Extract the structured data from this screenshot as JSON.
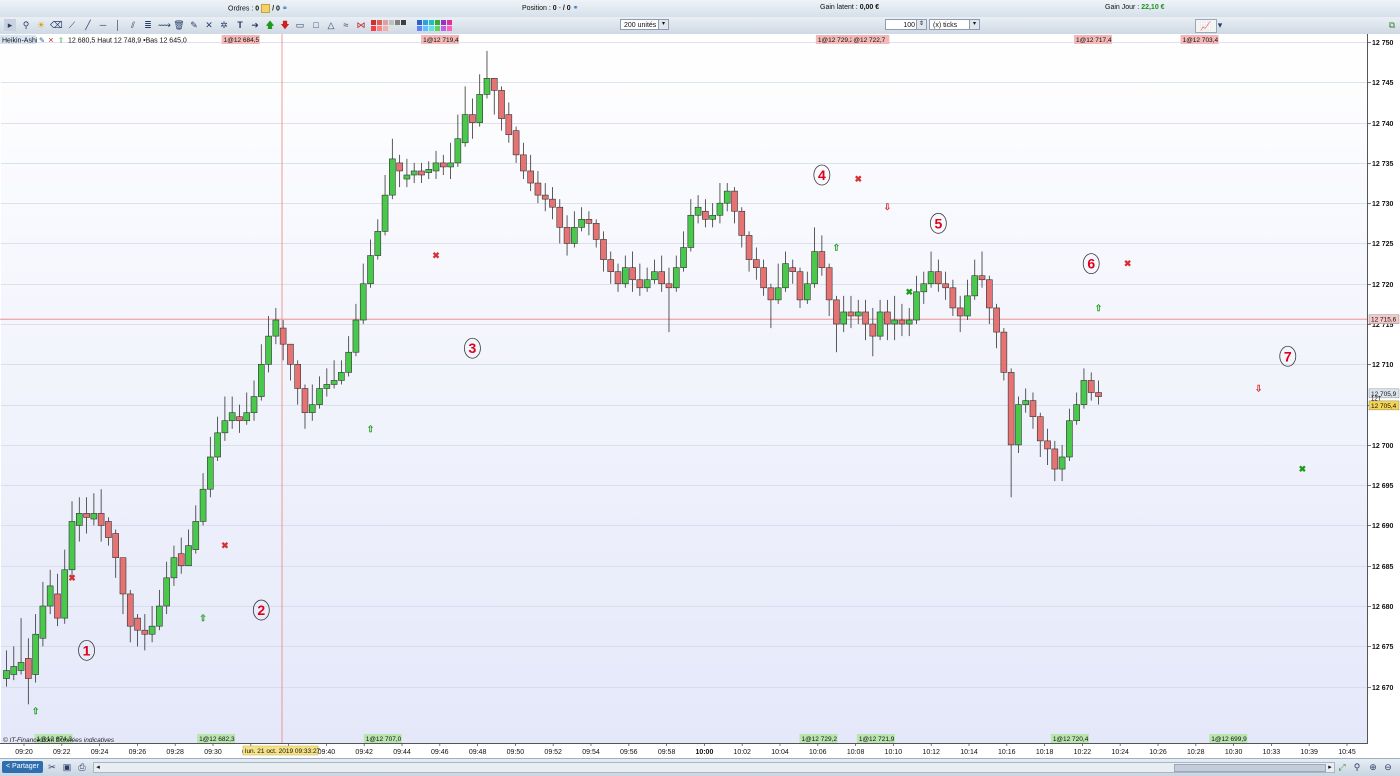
{
  "topbar": {
    "orders_label": "Ordres :",
    "orders_value": "0",
    "orders_sep": "/ 0",
    "position_label": "Position :",
    "position_value": "0",
    "position_dash": "-",
    "position_sep": "/ 0",
    "gain_latent_label": "Gain latent :",
    "gain_latent_value": "0,00 €",
    "gain_jour_label": "Gain Jour :",
    "gain_jour_value": "22,10 €"
  },
  "toolbar": {
    "units_select": "200 unités",
    "ticks_qty": "100",
    "ticks_select": "(x) ticks"
  },
  "legend": {
    "chart_label": "Heikin-Ashi",
    "hl_text": "12 680,5 Haut 12 748,9 •Bas 12 645,0"
  },
  "footer": {
    "copyright": "© IT-Finance.com Données indicatives",
    "date_cursor": "lun. 21 oct. 2019 09:33:27"
  },
  "bottombar": {
    "share_label": "Partager"
  },
  "colors": {
    "bull": "#49c84c",
    "bear": "#e67373",
    "background_top": "#ffffff",
    "background_bottom": "#e4e8f9",
    "crosshair": "#ee8080",
    "annotation": "#e0001a"
  },
  "chart_data": {
    "type": "candlestick",
    "series_name": "Heikin-Ashi",
    "y_ticks": [
      12670,
      12675,
      12680,
      12685,
      12690,
      12695,
      12700,
      12705,
      12710,
      12715,
      12720,
      12725,
      12730,
      12735,
      12740,
      12745,
      12750
    ],
    "y_tick_labels": [
      "12 670",
      "12 675",
      "12 680",
      "12 685",
      "12 690",
      "12 695",
      "12 700",
      "12 705",
      "12 710",
      "12 715",
      "12 720",
      "12 725",
      "12 730",
      "12 735",
      "12 740",
      "12 745",
      "12 750"
    ],
    "ylim": [
      12663,
      12751
    ],
    "x_labels": [
      "09:20",
      "09:22",
      "09:24",
      "09:26",
      "09:28",
      "09:30",
      "09:36",
      "09:38",
      "09:40",
      "09:42",
      "09:44",
      "09:46",
      "09:48",
      "09:50",
      "09:52",
      "09:54",
      "09:56",
      "09:58",
      "10:00",
      "10:02",
      "10:04",
      "10:06",
      "10:08",
      "10:10",
      "10:12",
      "10:14",
      "10:16",
      "10:18",
      "10:22",
      "10:24",
      "10:26",
      "10:28",
      "10:30",
      "10:33",
      "10:39",
      "10:45"
    ],
    "crosshair_price_label": "12 715,6",
    "crosshair_price": 12715.6,
    "last_price_label": "12 705,9",
    "last_price": 12705.9,
    "ticks_badge": "12T",
    "second_price_label": "12 705,4",
    "second_price": 12705.4,
    "candles": [
      [
        12671.0,
        12672.0,
        12674.5,
        12670.0
      ],
      [
        12671.5,
        12672.5,
        12675.0,
        12670.8
      ],
      [
        12672.0,
        12673.0,
        12678.5,
        12671.5
      ],
      [
        12673.5,
        12671.0,
        12676.0,
        12667.8
      ],
      [
        12671.5,
        12676.5,
        12679.0,
        12670.5
      ],
      [
        12676.0,
        12680.0,
        12683.0,
        12675.0
      ],
      [
        12680.0,
        12682.5,
        12684.5,
        12679.0
      ],
      [
        12681.5,
        12678.5,
        12684.0,
        12677.5
      ],
      [
        12678.5,
        12684.5,
        12687.0,
        12677.8
      ],
      [
        12684.5,
        12690.5,
        12693.0,
        12683.5
      ],
      [
        12690.0,
        12691.5,
        12693.5,
        12688.0
      ],
      [
        12691.5,
        12691.0,
        12693.5,
        12689.0
      ],
      [
        12690.8,
        12691.5,
        12694.0,
        12690.0
      ],
      [
        12691.5,
        12690.0,
        12694.5,
        12688.0
      ],
      [
        12690.5,
        12688.5,
        12691.0,
        12687.5
      ],
      [
        12689.0,
        12686.0,
        12689.5,
        12683.5
      ],
      [
        12686.0,
        12681.5,
        12686.0,
        12679.0
      ],
      [
        12681.5,
        12677.5,
        12682.0,
        12675.5
      ],
      [
        12678.5,
        12677.0,
        12679.0,
        12675.0
      ],
      [
        12677.0,
        12676.5,
        12679.0,
        12674.5
      ],
      [
        12676.5,
        12677.5,
        12680.0,
        12675.5
      ],
      [
        12677.5,
        12680.0,
        12682.0,
        12677.0
      ],
      [
        12680.0,
        12683.5,
        12685.5,
        12679.0
      ],
      [
        12683.5,
        12686.0,
        12687.5,
        12682.5
      ],
      [
        12686.5,
        12685.0,
        12688.5,
        12684.0
      ],
      [
        12685.0,
        12687.5,
        12689.5,
        12685.0
      ],
      [
        12687.0,
        12690.5,
        12692.5,
        12686.5
      ],
      [
        12690.5,
        12694.5,
        12696.5,
        12690.0
      ],
      [
        12694.5,
        12698.5,
        12701.0,
        12693.5
      ],
      [
        12698.5,
        12701.5,
        12703.5,
        12698.0
      ],
      [
        12701.5,
        12703.0,
        12706.0,
        12700.5
      ],
      [
        12703.0,
        12704.0,
        12706.0,
        12702.0
      ],
      [
        12703.5,
        12703.0,
        12705.0,
        12701.5
      ],
      [
        12703.0,
        12704.0,
        12706.5,
        12702.5
      ],
      [
        12704.0,
        12706.0,
        12708.0,
        12703.0
      ],
      [
        12706.0,
        12710.0,
        12712.5,
        12705.5
      ],
      [
        12710.0,
        12713.5,
        12716.0,
        12709.0
      ],
      [
        12713.5,
        12715.5,
        12717.0,
        12712.5
      ],
      [
        12714.5,
        12712.5,
        12715.5,
        12710.5
      ],
      [
        12712.5,
        12710.0,
        12712.5,
        12708.0
      ],
      [
        12710.0,
        12707.0,
        12710.5,
        12705.0
      ],
      [
        12707.0,
        12704.0,
        12707.5,
        12702.0
      ],
      [
        12704.0,
        12705.0,
        12707.5,
        12703.0
      ],
      [
        12705.0,
        12707.0,
        12708.5,
        12704.5
      ],
      [
        12707.0,
        12707.5,
        12709.5,
        12706.0
      ],
      [
        12707.5,
        12708.0,
        12710.5,
        12707.0
      ],
      [
        12708.0,
        12709.0,
        12710.5,
        12707.5
      ],
      [
        12709.0,
        12711.5,
        12713.5,
        12708.5
      ],
      [
        12711.5,
        12715.5,
        12717.5,
        12711.0
      ],
      [
        12715.5,
        12720.0,
        12722.5,
        12715.0
      ],
      [
        12720.0,
        12723.5,
        12725.5,
        12719.5
      ],
      [
        12723.5,
        12726.5,
        12728.0,
        12723.0
      ],
      [
        12726.5,
        12731.0,
        12733.5,
        12726.0
      ],
      [
        12731.0,
        12735.5,
        12738.0,
        12730.5
      ],
      [
        12735.0,
        12734.0,
        12736.0,
        12732.0
      ],
      [
        12733.0,
        12733.5,
        12735.5,
        12732.0
      ],
      [
        12733.5,
        12734.0,
        12735.0,
        12732.5
      ],
      [
        12734.0,
        12733.5,
        12735.0,
        12732.5
      ],
      [
        12733.8,
        12734.2,
        12735.2,
        12733.0
      ],
      [
        12734.0,
        12735.0,
        12736.5,
        12733.0
      ],
      [
        12735.0,
        12734.5,
        12736.0,
        12733.5
      ],
      [
        12734.5,
        12735.0,
        12737.5,
        12733.0
      ],
      [
        12735.0,
        12738.0,
        12741.0,
        12734.5
      ],
      [
        12737.5,
        12741.0,
        12744.5,
        12737.0
      ],
      [
        12741.0,
        12740.0,
        12743.0,
        12738.0
      ],
      [
        12740.0,
        12743.5,
        12746.0,
        12739.5
      ],
      [
        12743.5,
        12745.5,
        12748.9,
        12743.0
      ],
      [
        12745.5,
        12744.0,
        12745.5,
        12741.0
      ],
      [
        12744.0,
        12740.5,
        12744.5,
        12739.0
      ],
      [
        12741.0,
        12738.5,
        12742.5,
        12737.5
      ],
      [
        12739.0,
        12736.0,
        12739.5,
        12735.0
      ],
      [
        12736.0,
        12734.0,
        12737.5,
        12733.0
      ],
      [
        12734.0,
        12732.5,
        12736.0,
        12731.5
      ],
      [
        12732.5,
        12731.0,
        12734.0,
        12730.0
      ],
      [
        12731.0,
        12730.5,
        12732.5,
        12729.0
      ],
      [
        12730.5,
        12729.5,
        12732.0,
        12728.0
      ],
      [
        12729.5,
        12727.0,
        12730.5,
        12725.0
      ],
      [
        12727.0,
        12725.0,
        12728.5,
        12723.5
      ],
      [
        12725.0,
        12727.0,
        12729.0,
        12724.5
      ],
      [
        12727.0,
        12728.0,
        12729.5,
        12726.5
      ],
      [
        12728.0,
        12727.5,
        12729.0,
        12726.0
      ],
      [
        12727.5,
        12725.5,
        12728.0,
        12724.5
      ],
      [
        12725.5,
        12723.0,
        12726.5,
        12721.5
      ],
      [
        12723.0,
        12721.5,
        12724.0,
        12720.0
      ],
      [
        12721.5,
        12720.0,
        12722.5,
        12719.0
      ],
      [
        12720.0,
        12722.0,
        12723.5,
        12719.5
      ],
      [
        12722.0,
        12720.5,
        12724.0,
        12719.0
      ],
      [
        12720.5,
        12719.5,
        12722.5,
        12718.5
      ],
      [
        12719.5,
        12720.5,
        12722.0,
        12719.0
      ],
      [
        12720.5,
        12721.5,
        12723.0,
        12720.0
      ],
      [
        12721.5,
        12720.0,
        12723.5,
        12719.0
      ],
      [
        12720.0,
        12719.5,
        12722.0,
        12714.0
      ],
      [
        12719.5,
        12722.0,
        12723.5,
        12719.0
      ],
      [
        12722.0,
        12724.5,
        12726.5,
        12721.5
      ],
      [
        12724.5,
        12728.5,
        12730.5,
        12724.0
      ],
      [
        12728.5,
        12729.5,
        12731.0,
        12727.5
      ],
      [
        12729.0,
        12728.0,
        12730.5,
        12727.0
      ],
      [
        12728.0,
        12728.5,
        12730.0,
        12727.0
      ],
      [
        12728.5,
        12730.0,
        12732.5,
        12727.5
      ],
      [
        12730.0,
        12731.5,
        12732.5,
        12729.0
      ],
      [
        12731.5,
        12729.0,
        12732.0,
        12727.5
      ],
      [
        12729.0,
        12726.0,
        12729.5,
        12724.5
      ],
      [
        12726.0,
        12723.0,
        12726.5,
        12721.5
      ],
      [
        12723.0,
        12722.0,
        12724.5,
        12720.5
      ],
      [
        12722.0,
        12719.5,
        12723.0,
        12718.5
      ],
      [
        12719.5,
        12718.0,
        12720.0,
        12714.5
      ],
      [
        12718.0,
        12719.5,
        12722.5,
        12717.5
      ],
      [
        12719.5,
        12722.5,
        12724.0,
        12719.0
      ],
      [
        12722.0,
        12721.5,
        12723.0,
        12720.0
      ],
      [
        12721.5,
        12718.0,
        12722.0,
        12717.0
      ],
      [
        12718.0,
        12720.0,
        12721.5,
        12717.5
      ],
      [
        12720.0,
        12724.0,
        12727.0,
        12719.5
      ],
      [
        12724.0,
        12722.0,
        12726.0,
        12721.0
      ],
      [
        12722.0,
        12718.0,
        12722.5,
        12716.0
      ],
      [
        12718.0,
        12715.0,
        12718.5,
        12711.5
      ],
      [
        12715.0,
        12716.5,
        12718.5,
        12714.0
      ],
      [
        12716.5,
        12716.0,
        12718.5,
        12714.5
      ],
      [
        12716.0,
        12716.5,
        12718.0,
        12715.0
      ],
      [
        12716.5,
        12715.0,
        12718.0,
        12713.0
      ],
      [
        12715.0,
        12713.5,
        12717.0,
        12711.0
      ],
      [
        12713.5,
        12716.5,
        12718.0,
        12713.0
      ],
      [
        12716.5,
        12715.0,
        12718.0,
        12713.0
      ],
      [
        12715.0,
        12715.5,
        12718.5,
        12713.0
      ],
      [
        12715.5,
        12715.0,
        12717.5,
        12713.5
      ],
      [
        12715.0,
        12715.5,
        12717.0,
        12713.5
      ],
      [
        12715.5,
        12719.0,
        12721.0,
        12715.0
      ],
      [
        12719.0,
        12720.0,
        12721.5,
        12717.5
      ],
      [
        12720.0,
        12721.5,
        12724.0,
        12719.5
      ],
      [
        12721.5,
        12720.0,
        12723.0,
        12719.0
      ],
      [
        12720.0,
        12719.5,
        12721.5,
        12718.0
      ],
      [
        12719.5,
        12717.0,
        12720.5,
        12716.0
      ],
      [
        12717.0,
        12716.0,
        12718.5,
        12714.0
      ],
      [
        12716.0,
        12718.5,
        12720.5,
        12715.5
      ],
      [
        12718.5,
        12721.0,
        12723.0,
        12718.0
      ],
      [
        12721.0,
        12720.5,
        12724.0,
        12719.5
      ],
      [
        12720.5,
        12717.0,
        12721.0,
        12715.0
      ],
      [
        12717.0,
        12714.0,
        12717.5,
        12712.0
      ],
      [
        12714.0,
        12709.0,
        12714.5,
        12708.0
      ],
      [
        12709.0,
        12700.0,
        12709.5,
        12693.5
      ],
      [
        12700.0,
        12705.0,
        12706.0,
        12699.0
      ],
      [
        12705.0,
        12705.5,
        12707.0,
        12704.0
      ],
      [
        12705.5,
        12703.5,
        12706.5,
        12702.0
      ],
      [
        12703.5,
        12700.5,
        12704.0,
        12698.5
      ],
      [
        12700.5,
        12699.5,
        12702.0,
        12697.5
      ],
      [
        12699.5,
        12697.0,
        12700.5,
        12695.5
      ],
      [
        12697.0,
        12698.5,
        12700.0,
        12695.5
      ],
      [
        12698.5,
        12703.0,
        12704.5,
        12698.0
      ],
      [
        12703.0,
        12705.0,
        12706.5,
        12702.5
      ],
      [
        12705.0,
        12708.0,
        12709.5,
        12704.5
      ],
      [
        12708.0,
        12706.5,
        12709.0,
        12705.5
      ],
      [
        12706.5,
        12706.0,
        12708.0,
        12705.0
      ]
    ],
    "top_labels": [
      {
        "text": "1@12 684,5",
        "x_frac": 0.163
      },
      {
        "text": "1@12 719,4",
        "x_frac": 0.309
      },
      {
        "text": "1@12 729,2",
        "x_frac": 0.598
      },
      {
        "text": "@12 722,7",
        "x_frac": 0.624
      },
      {
        "text": "1@12 717,4",
        "x_frac": 0.787
      },
      {
        "text": "1@12 703,4",
        "x_frac": 0.865
      }
    ],
    "bottom_labels": [
      {
        "text": "1@12 674,3",
        "x_frac": 0.026
      },
      {
        "text": "1@12 682,3",
        "x_frac": 0.145
      },
      {
        "text": "1@12 707,0",
        "x_frac": 0.267
      },
      {
        "text": "1@12 729,2",
        "x_frac": 0.586
      },
      {
        "text": "1@12 721,9",
        "x_frac": 0.628
      },
      {
        "text": "1@12 720,4",
        "x_frac": 0.77
      },
      {
        "text": "1@12 699,9",
        "x_frac": 0.886
      }
    ],
    "annotations": [
      {
        "text": "1",
        "idx": 11,
        "price": 12674.5
      },
      {
        "text": "2",
        "idx": 35,
        "price": 12679.5
      },
      {
        "text": "3",
        "idx": 64,
        "price": 12712.0
      },
      {
        "text": "4",
        "idx": 112,
        "price": 12733.5
      },
      {
        "text": "5",
        "idx": 128,
        "price": 12727.5
      },
      {
        "text": "6",
        "idx": 149,
        "price": 12722.5
      },
      {
        "text": "7",
        "idx": 176,
        "price": 12711.0
      }
    ],
    "markers": [
      {
        "type": "buy-arrow",
        "idx": 4,
        "price": 12667.0
      },
      {
        "type": "sell-x",
        "idx": 9,
        "price": 12683.5
      },
      {
        "type": "buy-arrow",
        "idx": 27,
        "price": 12678.5
      },
      {
        "type": "sell-x",
        "idx": 30,
        "price": 12687.5
      },
      {
        "type": "buy-arrow",
        "idx": 50,
        "price": 12702.0
      },
      {
        "type": "sell-x",
        "idx": 59,
        "price": 12723.5
      },
      {
        "type": "buy-arrow",
        "idx": 114,
        "price": 12724.5
      },
      {
        "type": "sell-x",
        "idx": 117,
        "price": 12733.0
      },
      {
        "type": "sell-arrow",
        "idx": 121,
        "price": 12729.5
      },
      {
        "type": "buy-x",
        "idx": 124,
        "price": 12719.0
      },
      {
        "type": "buy-arrow",
        "idx": 150,
        "price": 12717.0
      },
      {
        "type": "sell-x",
        "idx": 154,
        "price": 12722.5
      },
      {
        "type": "sell-arrow",
        "idx": 172,
        "price": 12707.0
      },
      {
        "type": "buy-x",
        "idx": 178,
        "price": 12697.0
      }
    ]
  }
}
